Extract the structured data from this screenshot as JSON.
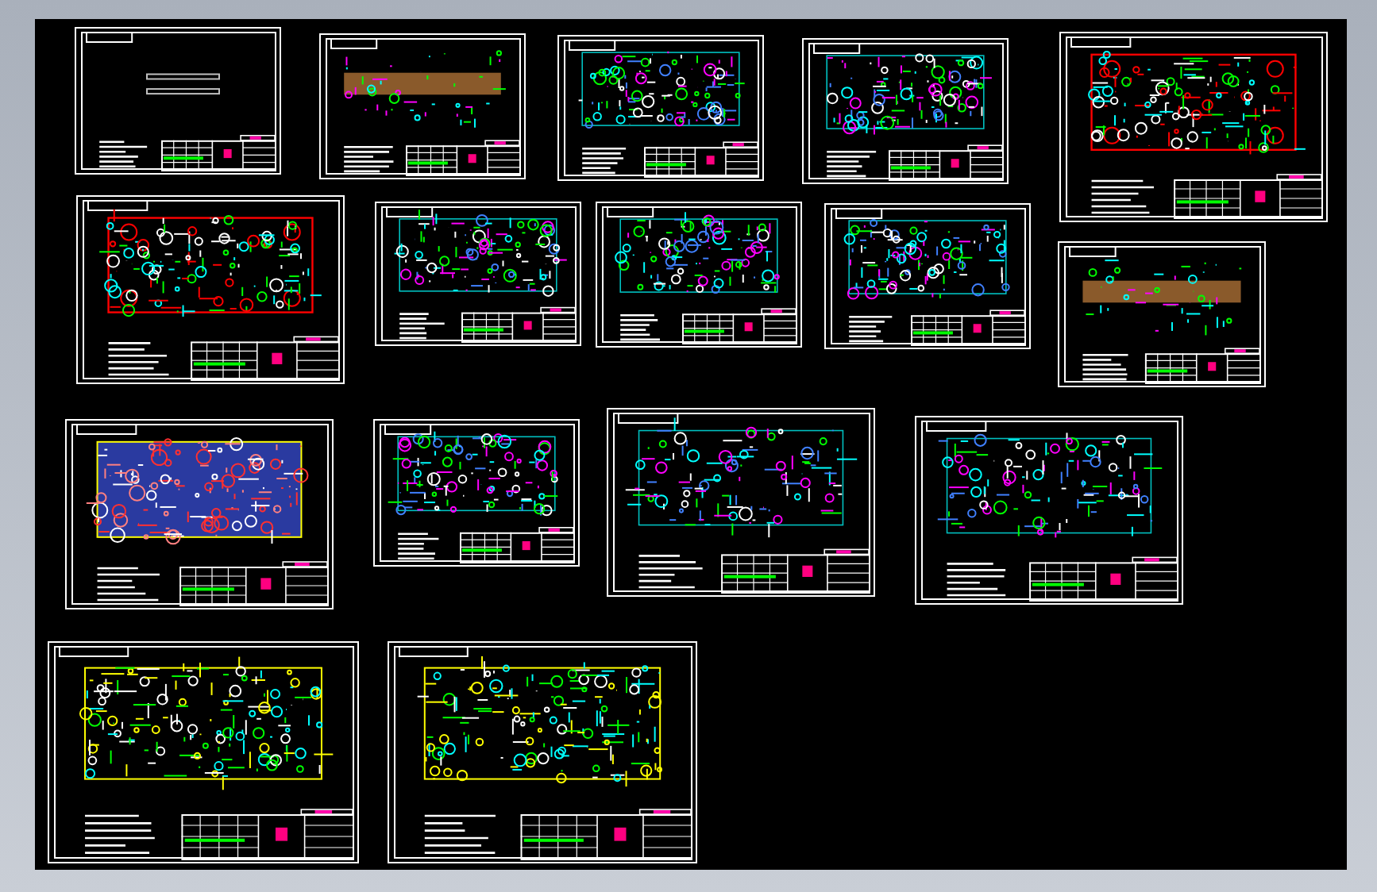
{
  "sheets": [
    {
      "kind": "strip"
    },
    {
      "kind": "band"
    },
    {
      "kind": "cyan"
    },
    {
      "kind": "cyan"
    },
    {
      "kind": "red"
    },
    {
      "kind": "red"
    },
    {
      "kind": "cyan"
    },
    {
      "kind": "cyan"
    },
    {
      "kind": "cyan"
    },
    {
      "kind": "band"
    },
    {
      "kind": "plate"
    },
    {
      "kind": "cyan"
    },
    {
      "kind": "cyan"
    },
    {
      "kind": "cyan"
    },
    {
      "kind": "yellow"
    },
    {
      "kind": "yellow"
    }
  ]
}
